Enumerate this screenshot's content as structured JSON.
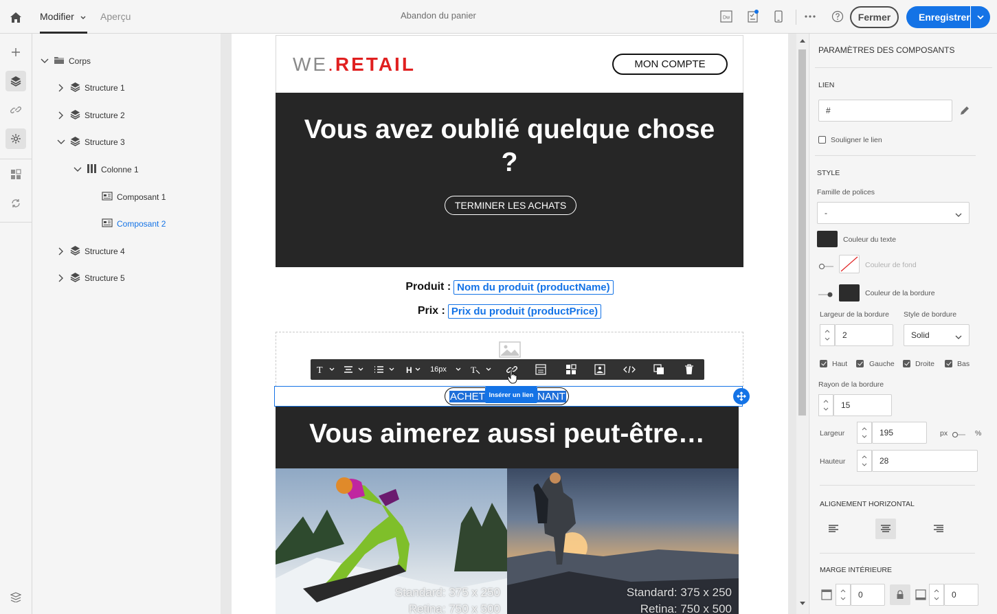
{
  "topbar": {
    "tab_edit": "Modifier",
    "tab_preview": "Aperçu",
    "title": "Abandon du panier",
    "close_label": "Fermer",
    "save_label": "Enregistrer",
    "dw_label": "Dw"
  },
  "rail": {
    "items": [
      "add-icon",
      "layers-icon",
      "link-icon",
      "personalization-icon",
      "fragments-icon",
      "sync-icon",
      "history-icon"
    ]
  },
  "tree": {
    "root": "Corps",
    "nodes": [
      {
        "label": "Structure 1"
      },
      {
        "label": "Structure 2"
      },
      {
        "label": "Structure 3"
      },
      {
        "label": "Colonne 1"
      },
      {
        "label": "Composant 1"
      },
      {
        "label": "Composant 2"
      },
      {
        "label": "Structure 4"
      },
      {
        "label": "Structure 5"
      }
    ]
  },
  "email": {
    "logo_part1": "WE",
    "logo_dot": ".",
    "logo_part2": "RETAIL",
    "account_button": "MON COMPTE",
    "hero_title": "Vous avez oublié quelque chose ?",
    "hero_button": "TERMINER LES ACHATS",
    "product_label": "Produit :",
    "product_value": "Nom du produit (productName)",
    "price_label": "Prix :",
    "price_value": "Prix du produit (productPrice)",
    "selected_button_left": "ACHET",
    "selected_button_right": "NANT",
    "tooltip": "Insérer un lien",
    "banner_title": "Vous aimerez aussi peut-être…",
    "photo1_caption_1": "Standard: 375 x 250",
    "photo1_caption_2": "Retina: 750 x 500",
    "photo2_caption_1": "Standard: 375 x 250",
    "photo2_caption_2": "Retina: 750 x 500"
  },
  "toolbar": {
    "font_size": "16px"
  },
  "panel": {
    "title": "PARAMÈTRES DES COMPOSANTS",
    "link_section": "LIEN",
    "link_value": "#",
    "underline_label": "Souligner le lien",
    "style_section": "STYLE",
    "font_family_label": "Famille de polices",
    "font_family_value": "-",
    "text_color_label": "Couleur du texte",
    "bg_color_label": "Couleur de fond",
    "border_color_label": "Couleur de la bordure",
    "border_width_label": "Largeur de la bordure",
    "border_width_value": "2",
    "border_style_label": "Style de bordure",
    "border_style_value": "Solid",
    "sides": [
      "Haut",
      "Gauche",
      "Droite",
      "Bas"
    ],
    "radius_label": "Rayon de la bordure",
    "radius_value": "15",
    "width_label": "Largeur",
    "width_value": "195",
    "unit_px": "px",
    "unit_pct": "%",
    "height_label": "Hauteur",
    "height_value": "28",
    "halign_section": "ALIGNEMENT HORIZONTAL",
    "padding_section": "MARGE INTÉRIEURE",
    "padding_top_value": "0",
    "padding_bottom_value": "0",
    "colors": {
      "text": "#2c2c2c",
      "border": "#2c2c2c",
      "accent": "#1473e6"
    }
  }
}
